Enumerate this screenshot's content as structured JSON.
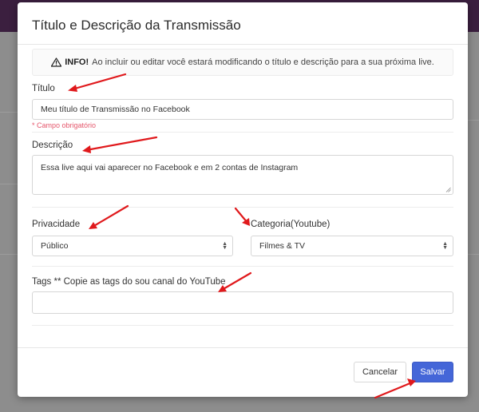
{
  "modal": {
    "title": "Título e Descrição da Transmissão",
    "info": {
      "icon": "warning-icon",
      "strong": "INFO!",
      "text": "Ao incluir ou editar você estará modificando o título e descrição para a sua próxima live."
    },
    "fields": {
      "title": {
        "label": "Título",
        "value": "Meu título de Transmissão no Facebook",
        "required_hint": "* Campo obrigatório"
      },
      "description": {
        "label": "Descrição",
        "value": "Essa live aqui vai aparecer no Facebook e em 2 contas de Instagram"
      },
      "privacy": {
        "label": "Privacidade",
        "selected": "Público"
      },
      "category": {
        "label": "Categoria(Youtube)",
        "selected": "Filmes & TV"
      },
      "tags": {
        "label": "Tags ** Copie as tags do sou canal do YouTube",
        "value": ""
      }
    },
    "buttons": {
      "cancel": "Cancelar",
      "save": "Salvar"
    }
  },
  "colors": {
    "primary": "#4466d8",
    "required": "#e5566b",
    "annotation_arrow": "#e0191c",
    "backdrop": "#8d8d8d",
    "topbar": "#3b1f3f"
  }
}
